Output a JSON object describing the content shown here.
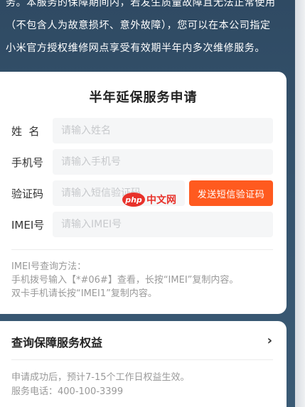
{
  "intro": {
    "line1": "务。本服务的保障期间内，若发生质量故障且无法正常使用",
    "line2": "（不包含人为故意损坏、意外故障），您可以在本公司指定",
    "line3": "小米官方授权维修网点享受有效期半年内多次维修服务。"
  },
  "apply": {
    "title": "半年延保服务申请",
    "name_label": "姓  名",
    "name_placeholder": "请输入姓名",
    "phone_label": "手机号",
    "phone_placeholder": "请输入手机号",
    "code_label": "验证码",
    "code_placeholder": "请输入短信验证码",
    "send_code": "发送短信验证码",
    "imei_label": "IMEI号",
    "imei_placeholder": "请输入IMEI号",
    "help_title": "IMEI号查询方法：",
    "help_line1": "手机拨号输入【*#06#】查看，长按“IMEI”复制内容。",
    "help_line2": "双卡手机请长按“IMEI1”复制内容。"
  },
  "watermark": {
    "badge": "php",
    "text": "中文网"
  },
  "rights": {
    "title": "查询保障服务权益",
    "chevron": "›",
    "note1": "申请成功后，预计7-15个工作日权益生效。",
    "note2": "服务电话：400-100-3399"
  },
  "colors": {
    "accent": "#ff5a1f",
    "background": "#35536d"
  }
}
